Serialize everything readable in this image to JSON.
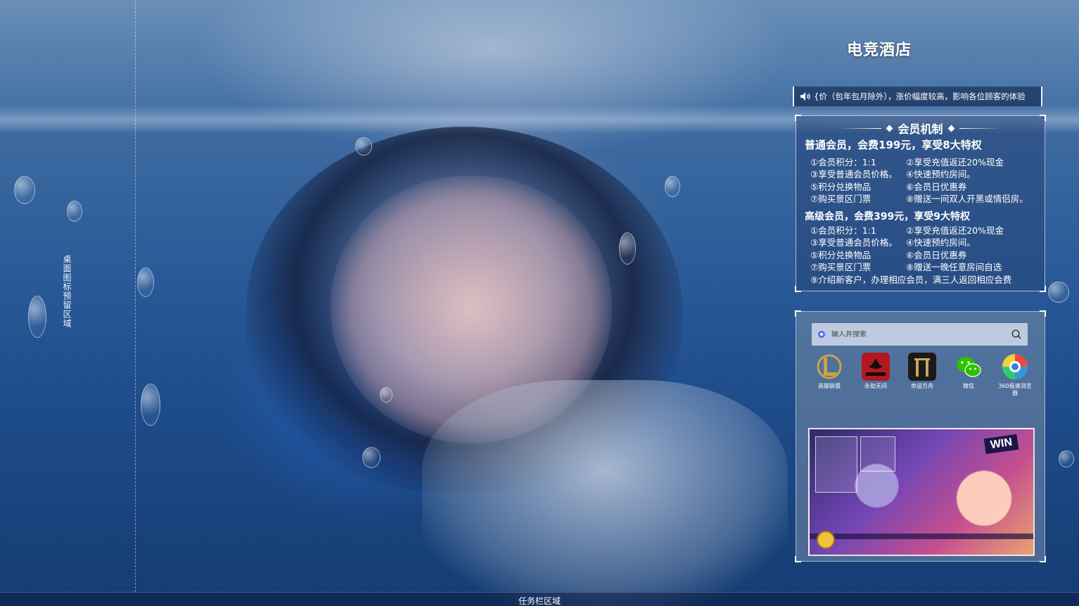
{
  "desktop": {
    "left_zone_label": "桌面图标预留区域",
    "taskbar_label": "任务栏区域"
  },
  "hotel": {
    "title": "电竞酒店"
  },
  "notice": {
    "icon": "speaker-icon",
    "text": "{价（包年包月除外），涨价幅度较高，影响各位顾客的体验"
  },
  "membership": {
    "title": "会员机制",
    "tiers": [
      {
        "heading": "普通会员，会费199元，享受8大特权",
        "perks": [
          [
            "①会员积分：1:1",
            "②享受充值返还20%现金"
          ],
          [
            "③享受普通会员价格。",
            "④快速预约房间。"
          ],
          [
            "⑤积分兑换物品",
            "⑥会员日优惠券"
          ],
          [
            "⑦购买景区门票",
            "⑧赠送一间双人开黑或情侣房。"
          ]
        ]
      },
      {
        "heading": "高级会员，会费399元，享受9大特权",
        "perks": [
          [
            "①会员积分：1:1",
            "②享受充值返还20%现金"
          ],
          [
            "③享受普通会员价格。",
            "④快速预约房间。"
          ],
          [
            "⑤积分兑换物品",
            "⑥会员日优惠券"
          ],
          [
            "⑦购买景区门票",
            "⑧赠送一晚任意房间自选"
          ],
          [
            "⑨介绍新客户，办理相应会员，满三人返回相应会费",
            ""
          ]
        ]
      }
    ]
  },
  "launcher": {
    "search": {
      "placeholder": "输入并搜索",
      "value": ""
    },
    "apps": [
      {
        "label": "英雄联盟",
        "icon": "league-of-legends-icon"
      },
      {
        "label": "永劫无间",
        "icon": "naraka-icon"
      },
      {
        "label": "命运方舟",
        "icon": "lost-ark-icon"
      },
      {
        "label": "微信",
        "icon": "wechat-icon"
      },
      {
        "label": "360极速浏览器",
        "icon": "360-browser-icon"
      }
    ],
    "banner": {
      "badge": "WIN"
    }
  },
  "colors": {
    "accent": "#ffffff",
    "panel_bg": "#28467a",
    "wechat_green": "#2dc100",
    "naraka_red": "#b3181f"
  }
}
